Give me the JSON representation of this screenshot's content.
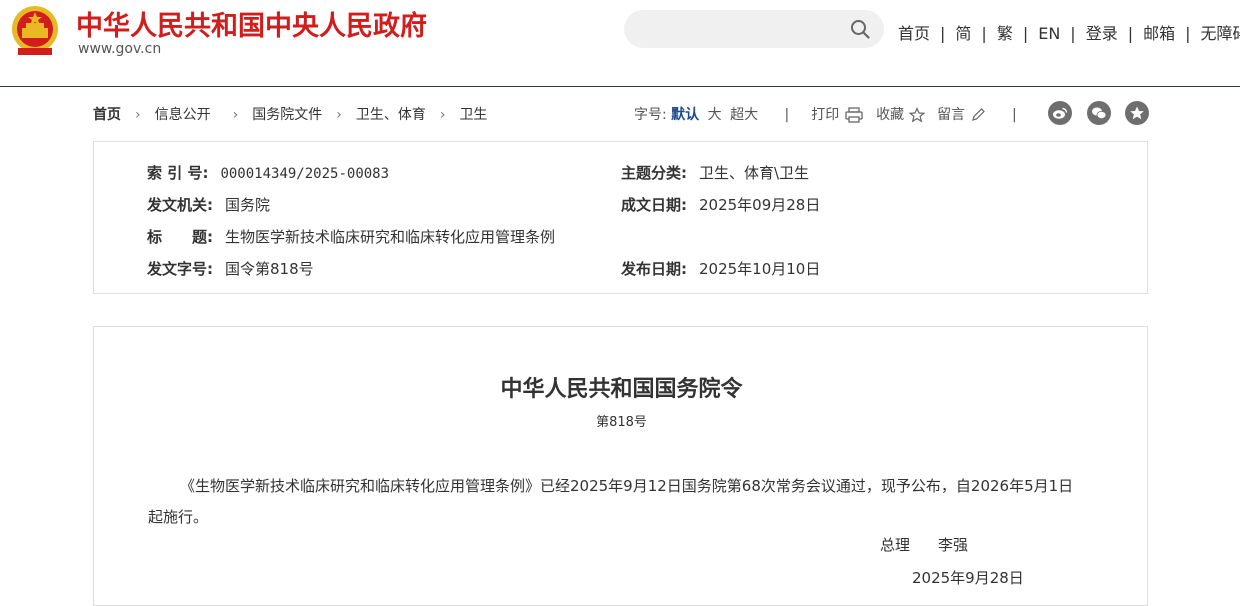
{
  "header": {
    "site_title": "中华人民共和国中央人民政府",
    "site_url": "www.gov.cn",
    "search": {
      "placeholder": "",
      "value": ""
    },
    "nav": [
      "首页",
      "简",
      "繁",
      "EN",
      "登录",
      "邮箱",
      "无障碍"
    ]
  },
  "breadcrumb": {
    "home": "首页",
    "items": [
      "信息公开",
      "国务院文件",
      "卫生、体育",
      "卫生"
    ]
  },
  "tools": {
    "font_label": "字号:",
    "font_default": "默认",
    "font_large": "大",
    "font_xlarge": "超大",
    "print": "打印",
    "favorite": "收藏",
    "comment": "留言"
  },
  "share_icons": [
    "weibo-icon",
    "wechat-icon",
    "star-icon"
  ],
  "info": {
    "index_key": "索 引 号:",
    "index_val": "000014349/2025-00083",
    "category_key": "主题分类:",
    "category_val": "卫生、体育\\卫生",
    "issuer_key": "发文机关:",
    "issuer_val": "国务院",
    "written_key": "成文日期:",
    "written_val": "2025年09月28日",
    "title_key": "标　　题:",
    "title_val": "生物医学新技术临床研究和临床转化应用管理条例",
    "docno_key": "发文字号:",
    "docno_val": "国令第818号",
    "published_key": "发布日期:",
    "published_val": "2025年10月10日"
  },
  "document": {
    "title": "中华人民共和国国务院令",
    "number": "第818号",
    "body": "《生物医学新技术临床研究和临床转化应用管理条例》已经2025年9月12日国务院第68次常务会议通过，现予公布，自2026年5月1日起施行。",
    "signer_title": "总理",
    "signer_name": "李强",
    "date": "2025年9月28日"
  },
  "colors": {
    "brand_red": "#d21d1d",
    "accent_blue": "#1e4a8a",
    "icon_gray": "#6e6e6e"
  }
}
